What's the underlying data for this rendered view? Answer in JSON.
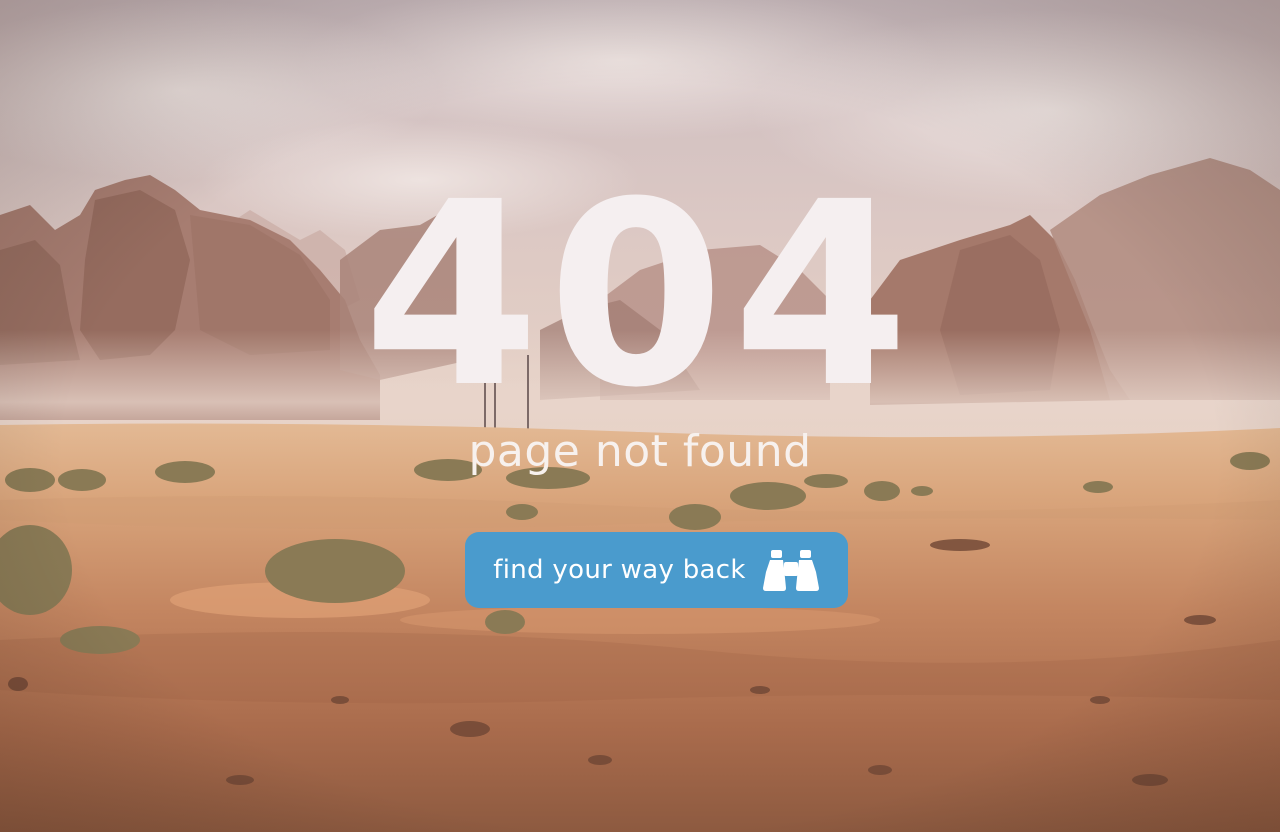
{
  "page": {
    "status_code": "404",
    "message": "page not found"
  },
  "action": {
    "label": "find your way back",
    "icon": "binoculars-icon"
  },
  "colors": {
    "button_bg": "#4a9bcd",
    "heading_text": "#f5eff0",
    "background_theme": "desert"
  }
}
